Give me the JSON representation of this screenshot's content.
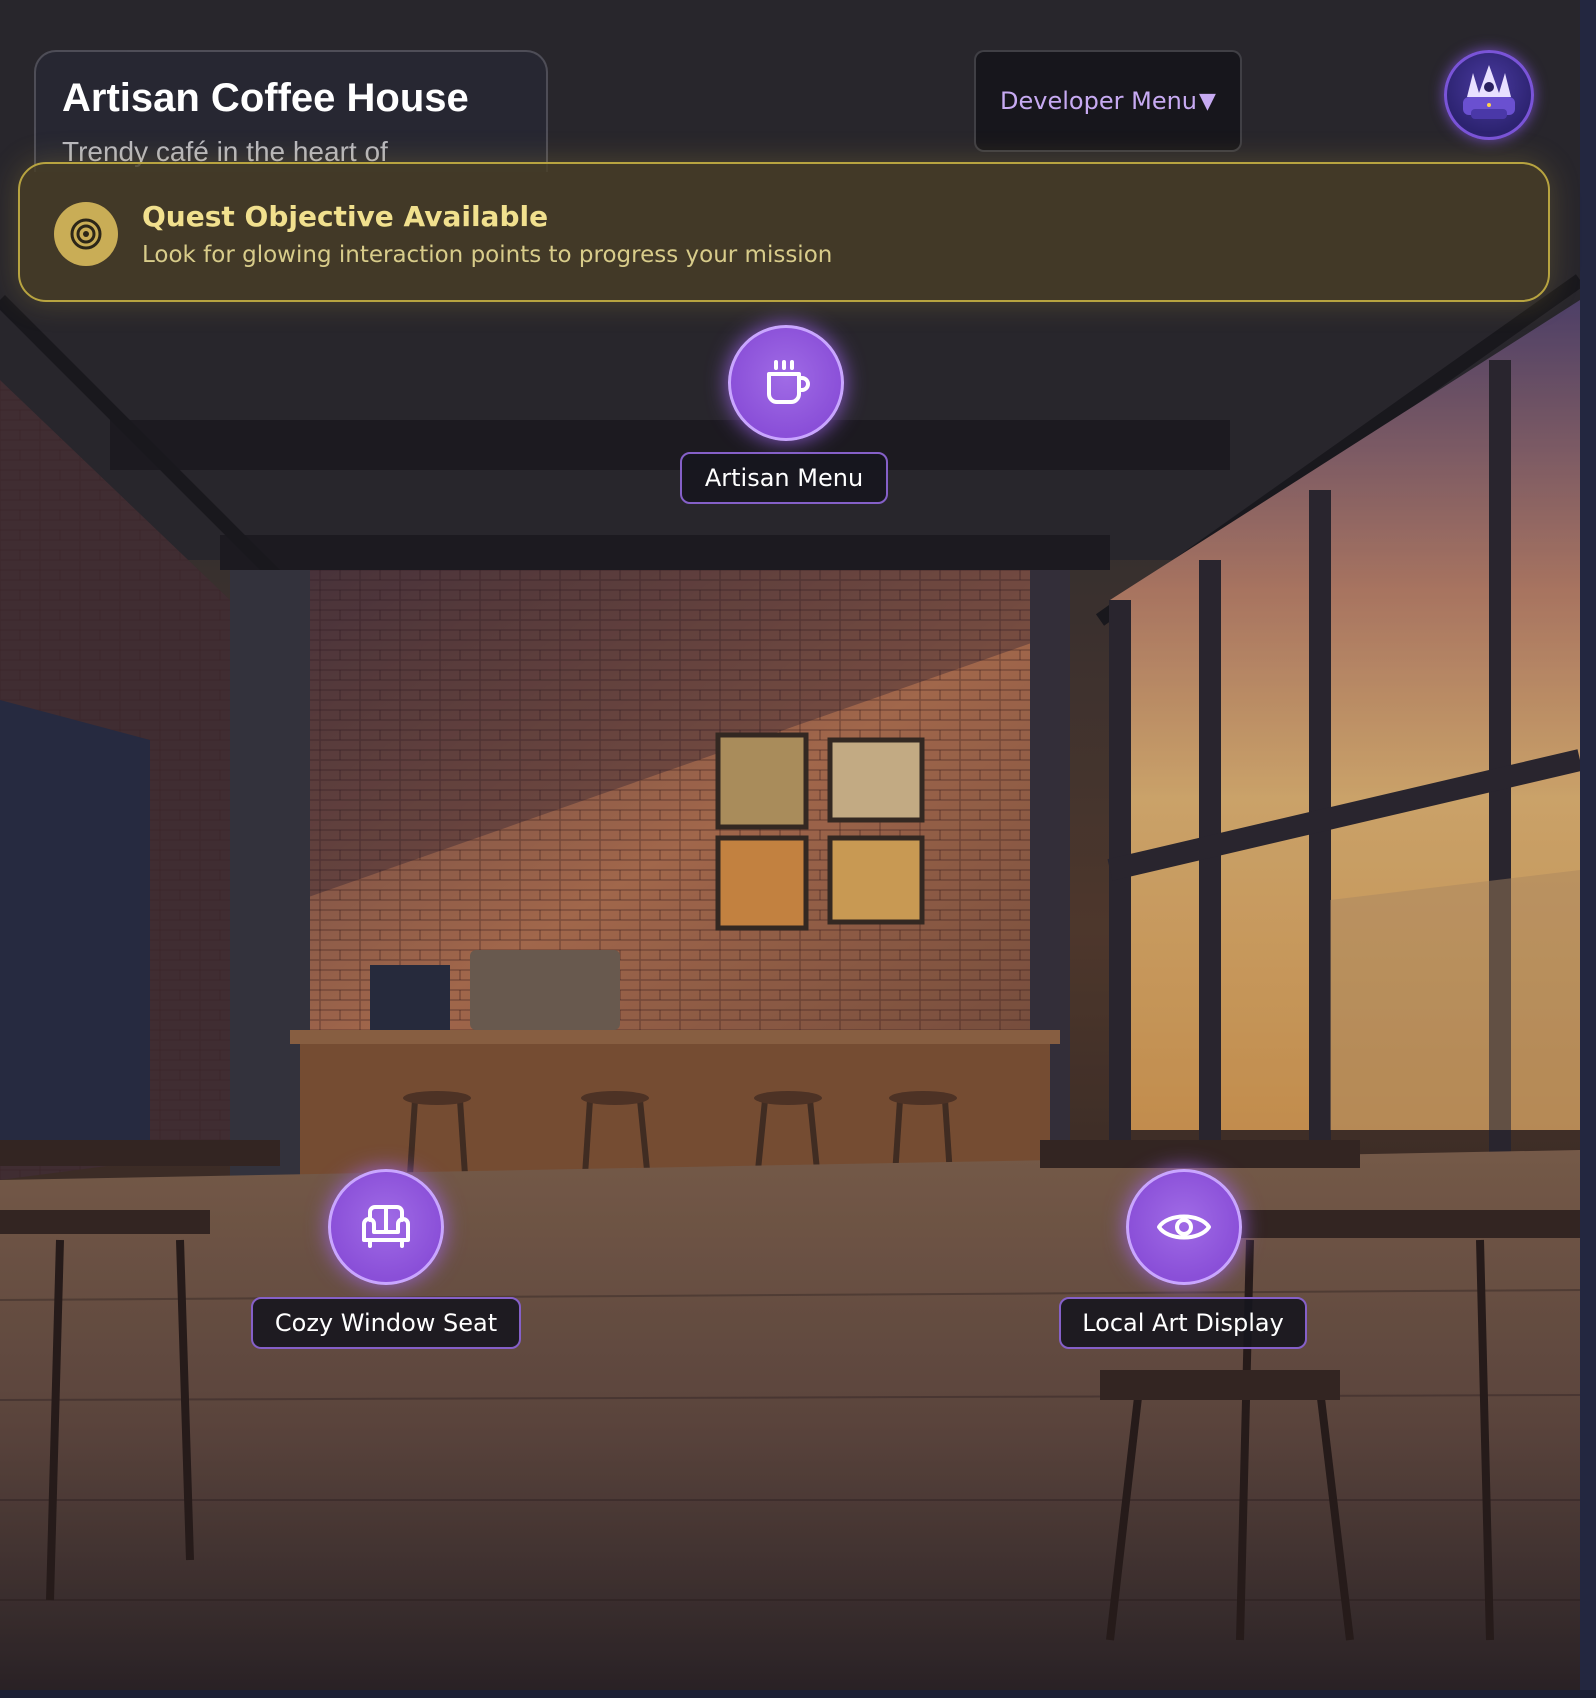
{
  "location": {
    "title": "Artisan Coffee House",
    "subtitle": "Trendy café in the heart of"
  },
  "developer_menu": {
    "label": "Developer Menu",
    "caret": "▼"
  },
  "avatar": {
    "icon": "crown-eye-emblem-icon"
  },
  "quest": {
    "title": "Quest Objective Available",
    "description": "Look for glowing interaction points to progress your mission",
    "icon": "target-icon",
    "accent": "#c9ad56"
  },
  "hotspots": [
    {
      "label": "Artisan Menu",
      "icon": "coffee-cup-icon"
    },
    {
      "label": "Cozy Window Seat",
      "icon": "sofa-icon"
    },
    {
      "label": "Local Art Display",
      "icon": "eye-icon"
    }
  ],
  "colors": {
    "hotspot": "#8a4fd8",
    "hotspot_border": "#c9a6ff",
    "quest_border": "#b8a440",
    "dev_menu_text": "#c7aaf2"
  }
}
